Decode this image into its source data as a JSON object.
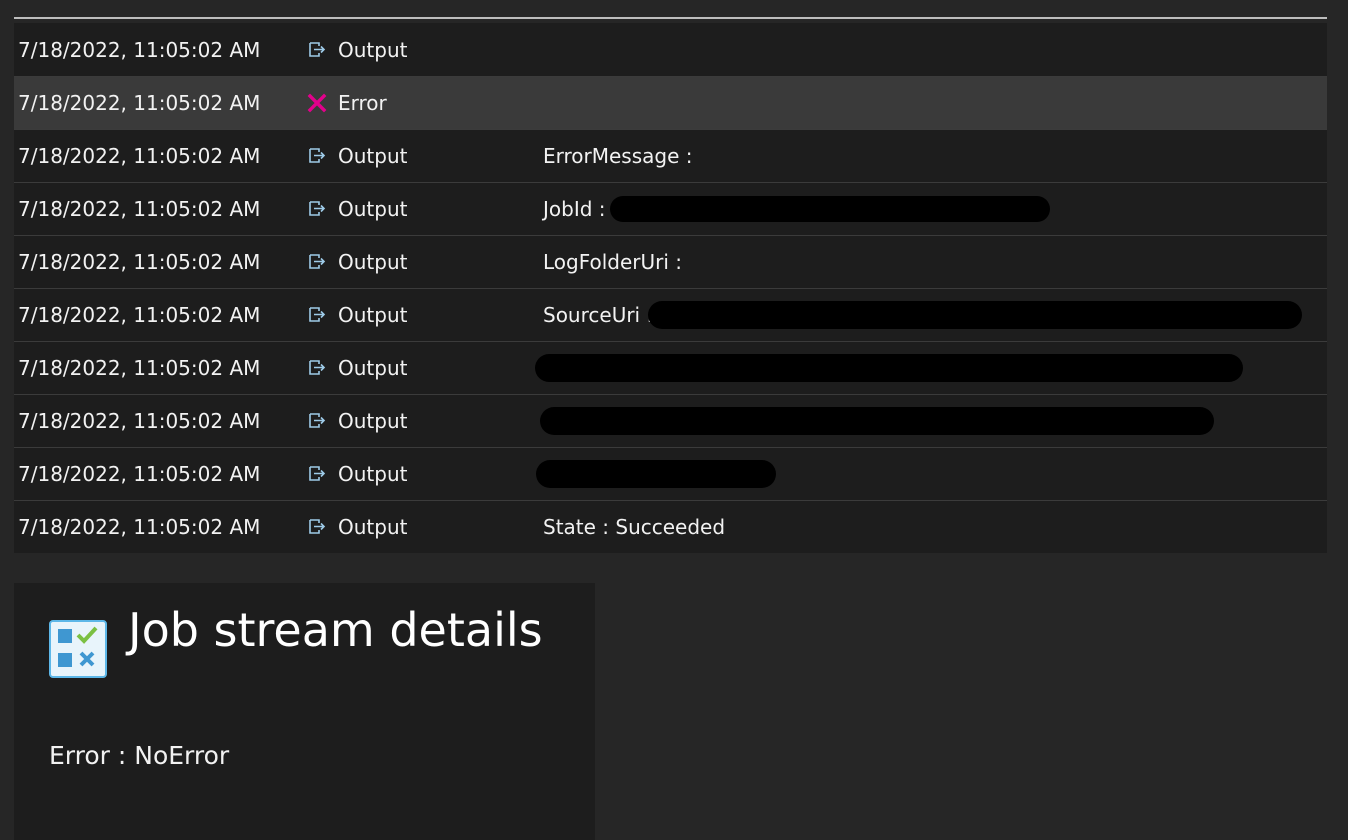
{
  "rows": [
    {
      "time": "7/18/2022, 11:05:02 AM",
      "type": "Output",
      "icon": "output-icon",
      "message": ""
    },
    {
      "time": "7/18/2022, 11:05:02 AM",
      "type": "Error",
      "icon": "error-x-icon",
      "message": ""
    },
    {
      "time": "7/18/2022, 11:05:02 AM",
      "type": "Output",
      "icon": "output-icon",
      "message": "ErrorMessage :"
    },
    {
      "time": "7/18/2022, 11:05:02 AM",
      "type": "Output",
      "icon": "output-icon",
      "message": "JobId :"
    },
    {
      "time": "7/18/2022, 11:05:02 AM",
      "type": "Output",
      "icon": "output-icon",
      "message": "LogFolderUri :"
    },
    {
      "time": "7/18/2022, 11:05:02 AM",
      "type": "Output",
      "icon": "output-icon",
      "message": "SourceUri :"
    },
    {
      "time": "7/18/2022, 11:05:02 AM",
      "type": "Output",
      "icon": "output-icon",
      "message": ""
    },
    {
      "time": "7/18/2022, 11:05:02 AM",
      "type": "Output",
      "icon": "output-icon",
      "message": ""
    },
    {
      "time": "7/18/2022, 11:05:02 AM",
      "type": "Output",
      "icon": "output-icon",
      "message": ""
    },
    {
      "time": "7/18/2022, 11:05:02 AM",
      "type": "Output",
      "icon": "output-icon",
      "message": "State : Succeeded"
    }
  ],
  "details": {
    "icon": "job-stream-details-icon",
    "title": "Job stream details",
    "text": "Error : NoError"
  },
  "colors": {
    "background": "#262626",
    "panel": "#1d1d1d",
    "selected_row": "#3a3a3a",
    "error_accent": "#e3008c",
    "output_icon": "#9ecbe8"
  }
}
